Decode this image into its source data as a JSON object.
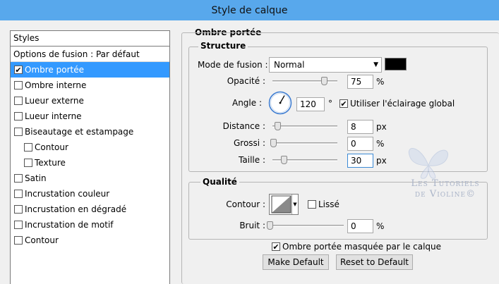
{
  "window": {
    "title": "Style de calque"
  },
  "left_panel": {
    "header": "Styles",
    "blend_options": "Options de fusion : Par défaut",
    "items": [
      {
        "label": "Ombre portée",
        "checked": true,
        "selected": true
      },
      {
        "label": "Ombre interne",
        "checked": false
      },
      {
        "label": "Lueur externe",
        "checked": false
      },
      {
        "label": "Lueur interne",
        "checked": false
      },
      {
        "label": "Biseautage et estampage",
        "checked": false
      },
      {
        "label": "Contour",
        "checked": false,
        "sub": true
      },
      {
        "label": "Texture",
        "checked": false,
        "sub": true
      },
      {
        "label": "Satin",
        "checked": false
      },
      {
        "label": "Incrustation couleur",
        "checked": false
      },
      {
        "label": "Incrustation en dégradé",
        "checked": false
      },
      {
        "label": "Incrustation de motif",
        "checked": false
      },
      {
        "label": "Contour",
        "checked": false
      }
    ]
  },
  "panel": {
    "title": "Ombre portée",
    "structure": {
      "title": "Structure",
      "blend_mode_label": "Mode de fusion :",
      "blend_mode_value": "Normal",
      "shadow_color": "#000000",
      "opacity_label": "Opacité :",
      "opacity_value": "75",
      "opacity_unit": "%",
      "opacity_level": 0.75,
      "angle_label": "Angle :",
      "angle_value": "120",
      "angle_unit": "°",
      "global_light_label": "Utiliser l'éclairage global",
      "global_light_checked": true,
      "distance_label": "Distance :",
      "distance_value": "8",
      "distance_unit": "px",
      "spread_label": "Grossi :",
      "spread_value": "0",
      "spread_unit": "%",
      "size_label": "Taille :",
      "size_value": "30",
      "size_unit": "px"
    },
    "quality": {
      "title": "Qualité",
      "contour_label": "Contour :",
      "antialiased_label": "Lissé",
      "antialiased_checked": false,
      "noise_label": "Bruit :",
      "noise_value": "0",
      "noise_unit": "%"
    },
    "knockout_label": "Ombre portée masquée par le calque",
    "knockout_checked": true,
    "make_default": "Make Default",
    "reset_default": "Reset to Default"
  },
  "watermark": {
    "line1": "Les Tutoriels",
    "line2": "de Violine©"
  }
}
